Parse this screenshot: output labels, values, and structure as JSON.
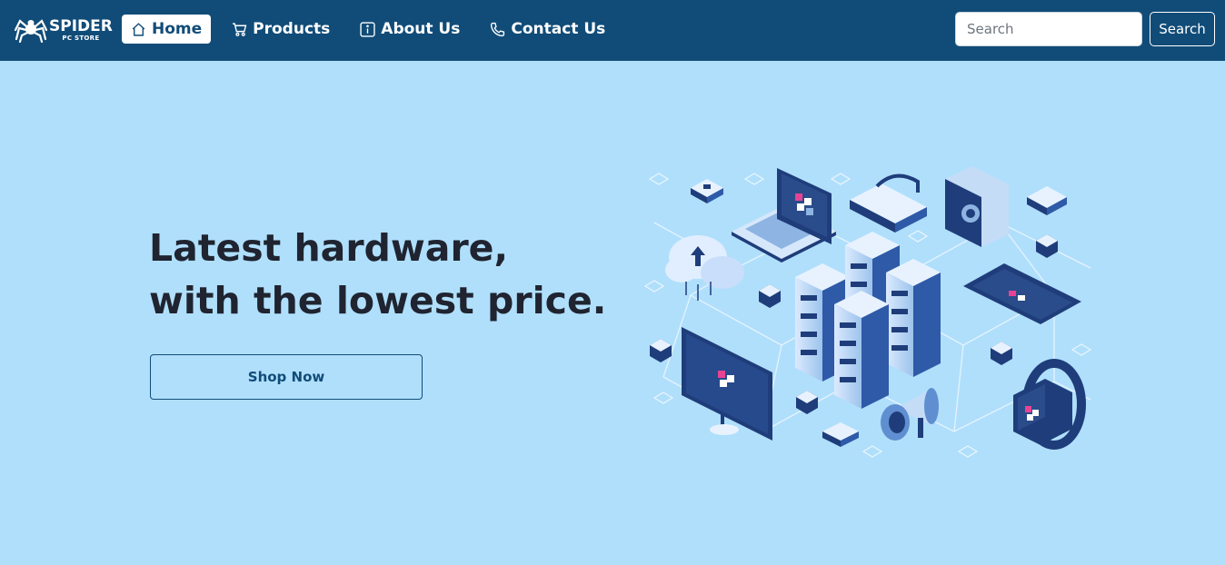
{
  "brand": {
    "title": "SPIDER",
    "subtitle": "PC STORE",
    "icon": "spider-logo"
  },
  "nav": {
    "items": [
      {
        "label": "Home",
        "icon": "home-icon",
        "active": true
      },
      {
        "label": "Products",
        "icon": "cart-icon",
        "active": false
      },
      {
        "label": "About Us",
        "icon": "info-icon",
        "active": false
      },
      {
        "label": "Contact Us",
        "icon": "phone-icon",
        "active": false
      }
    ]
  },
  "search": {
    "placeholder": "Search",
    "button_label": "Search"
  },
  "hero": {
    "title_line1": "Latest hardware,",
    "title_line2": "with the lowest price.",
    "cta_label": "Shop Now",
    "illustration": "isometric-hardware-network-illustration"
  },
  "colors": {
    "navbar": "#114c78",
    "background": "#b0dffc",
    "text": "#1f2430",
    "accent": "#114c78"
  }
}
